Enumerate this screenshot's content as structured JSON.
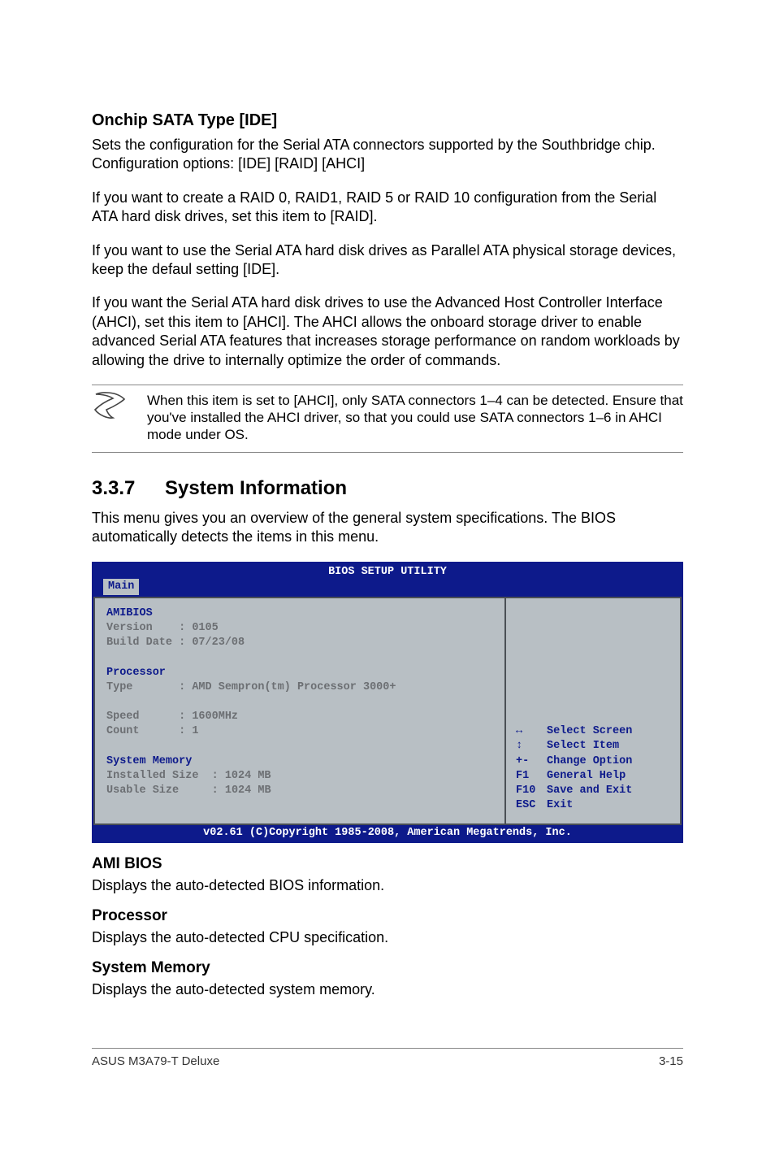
{
  "section1": {
    "heading": "Onchip SATA Type [IDE]",
    "p1": "Sets the configuration for the Serial ATA connectors supported by the Southbridge chip. Configuration options: [IDE] [RAID] [AHCI]",
    "p2": "If you want to create a RAID 0, RAID1, RAID 5 or RAID 10 configuration from the Serial ATA hard disk drives, set this item to [RAID].",
    "p3": "If you want to use the Serial ATA hard disk drives as Parallel ATA physical storage devices, keep the defaul setting [IDE].",
    "p4": "If you want the Serial ATA hard disk drives to use the Advanced Host Controller Interface (AHCI), set this item to [AHCI]. The AHCI allows the onboard storage driver to enable advanced Serial ATA features that increases storage performance on random workloads by allowing the drive to internally optimize the order of commands."
  },
  "note": {
    "text": "When this item is set to [AHCI], only SATA connectors 1–4 can be detected. Ensure that you've installed the AHCI driver, so that you could use SATA connectors 1–6 in AHCI mode under OS."
  },
  "section2": {
    "number": "3.3.7",
    "title": "System Information",
    "intro": "This menu gives you an overview of the general system specifications. The BIOS automatically detects the items in this menu."
  },
  "bios": {
    "title": "BIOS SETUP UTILITY",
    "tab": "Main",
    "amibios_label": "AMIBIOS",
    "version_label": "Version",
    "version_value": "0105",
    "builddate_label": "Build Date",
    "builddate_value": "07/23/08",
    "processor_label": "Processor",
    "type_label": "Type",
    "type_value": "AMD Sempron(tm) Processor 3000+",
    "speed_label": "Speed",
    "speed_value": "1600MHz",
    "count_label": "Count",
    "count_value": "1",
    "sysmem_label": "System Memory",
    "installed_label": "Installed Size",
    "installed_value": "1024 MB",
    "usable_label": "Usable Size",
    "usable_value": "1024 MB",
    "help": {
      "select_screen": "Select Screen",
      "select_item": "Select Item",
      "change_option_k": "+-",
      "change_option": "Change Option",
      "general_help_k": "F1",
      "general_help": "General Help",
      "save_exit_k": "F10",
      "save_exit": "Save and Exit",
      "exit_k": "ESC",
      "exit": "Exit"
    },
    "footer": "v02.61 (C)Copyright 1985-2008, American Megatrends, Inc."
  },
  "defs": {
    "amibios_h": "AMI BIOS",
    "amibios_t": "Displays the auto-detected BIOS information.",
    "proc_h": "Processor",
    "proc_t": "Displays the auto-detected CPU specification.",
    "mem_h": "System Memory",
    "mem_t": "Displays the auto-detected system memory."
  },
  "footer": {
    "product": "ASUS M3A79-T Deluxe",
    "page": "3-15"
  }
}
